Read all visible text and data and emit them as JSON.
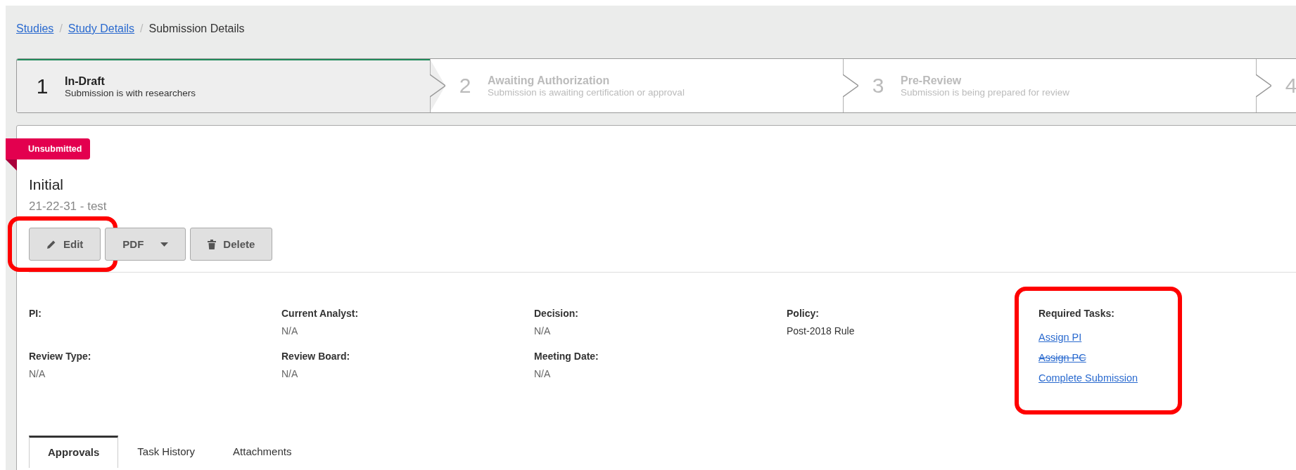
{
  "breadcrumb": {
    "separator": "/",
    "items": [
      {
        "label": "Studies",
        "link": true
      },
      {
        "label": "Study Details",
        "link": true
      },
      {
        "label": "Submission Details",
        "link": false
      }
    ]
  },
  "steps": [
    {
      "number": "1",
      "title": "In-Draft",
      "description": "Submission is with researchers",
      "selected": true
    },
    {
      "number": "2",
      "title": "Awaiting Authorization",
      "description": "Submission is awaiting certification or approval",
      "selected": false
    },
    {
      "number": "3",
      "title": "Pre-Review",
      "description": "Submission is being prepared for review",
      "selected": false
    },
    {
      "number": "4",
      "selected": false
    }
  ],
  "submission": {
    "status": "Unsubmitted",
    "title": "Initial",
    "subtitle": "21-22-31 - test"
  },
  "buttons": [
    {
      "kind": "edit",
      "label": "Edit",
      "highlighted": true
    },
    {
      "kind": "dropdown",
      "label": "PDF",
      "highlighted": false
    },
    {
      "kind": "delete",
      "label": "Delete",
      "highlighted": false
    }
  ],
  "fields": [
    {
      "label": "PI:"
    },
    {
      "label": "Current Analyst:",
      "value": "N/A"
    },
    {
      "label": "Decision:",
      "value": "N/A"
    },
    {
      "label": "Policy:",
      "value": "Post-2018 Rule"
    },
    {
      "label": "Review Type:",
      "value": "N/A"
    },
    {
      "label": "Review Board:",
      "value": "N/A"
    },
    {
      "label": "Meeting Date:",
      "value": "N/A"
    }
  ],
  "required_tasks": {
    "title": "Required Tasks:",
    "highlighted": true,
    "tasks": [
      {
        "label": "Assign PI",
        "done": false
      },
      {
        "label": "Assign PC",
        "done": true
      },
      {
        "label": "Complete Submission",
        "done": false
      }
    ]
  },
  "tabs": [
    {
      "label": "Approvals",
      "selected": true
    },
    {
      "label": "Task History",
      "selected": false
    },
    {
      "label": "Attachments",
      "selected": false
    }
  ]
}
